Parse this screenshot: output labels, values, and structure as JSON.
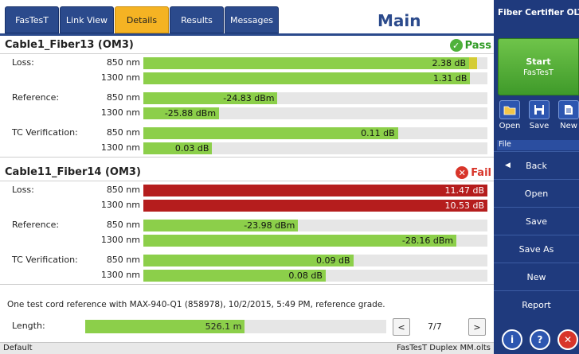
{
  "tabs": [
    "FasTesT",
    "Link View",
    "Details",
    "Results",
    "Messages"
  ],
  "active_tab": "Details",
  "main_title": "Main",
  "cables": [
    {
      "name": "Cable1_Fiber13 (OM3)",
      "verdict": "Pass",
      "verdict_icon": "check-icon",
      "rows": [
        {
          "label": "Loss:",
          "wavelength": "850 nm",
          "value": "2.38 dB",
          "level_pct": 97,
          "color": "green",
          "warn_tip": true
        },
        {
          "label": "",
          "wavelength": "1300 nm",
          "value": "1.31 dB",
          "level_pct": 95,
          "color": "green",
          "warn_tip": false
        },
        {
          "label": "Reference:",
          "wavelength": "850 nm",
          "value": "-24.83 dBm",
          "level_pct": 39,
          "color": "green",
          "warn_tip": false
        },
        {
          "label": "",
          "wavelength": "1300 nm",
          "value": "-25.88 dBm",
          "level_pct": 22,
          "color": "green",
          "warn_tip": false
        },
        {
          "label": "TC Verification:",
          "wavelength": "850 nm",
          "value": "0.11 dB",
          "level_pct": 74,
          "color": "green",
          "warn_tip": false
        },
        {
          "label": "",
          "wavelength": "1300 nm",
          "value": "0.03 dB",
          "level_pct": 20,
          "color": "green",
          "warn_tip": false
        }
      ]
    },
    {
      "name": "Cable11_Fiber14 (OM3)",
      "verdict": "Fail",
      "verdict_icon": "x-icon",
      "rows": [
        {
          "label": "Loss:",
          "wavelength": "850 nm",
          "value": "11.47 dB",
          "level_pct": 100,
          "color": "red",
          "warn_tip": false
        },
        {
          "label": "",
          "wavelength": "1300 nm",
          "value": "10.53 dB",
          "level_pct": 100,
          "color": "red",
          "warn_tip": false
        },
        {
          "label": "Reference:",
          "wavelength": "850 nm",
          "value": "-23.98 dBm",
          "level_pct": 45,
          "color": "green",
          "warn_tip": false
        },
        {
          "label": "",
          "wavelength": "1300 nm",
          "value": "-28.16 dBm",
          "level_pct": 91,
          "color": "green",
          "warn_tip": false
        },
        {
          "label": "TC Verification:",
          "wavelength": "850 nm",
          "value": "0.09 dB",
          "level_pct": 61,
          "color": "green",
          "warn_tip": false
        },
        {
          "label": "",
          "wavelength": "1300 nm",
          "value": "0.08 dB",
          "level_pct": 53,
          "color": "green",
          "warn_tip": false
        }
      ]
    }
  ],
  "reference_note": "One test cord reference with MAX-940-Q1 (858978), 10/2/2015, 5:49 PM, reference grade.",
  "length": {
    "label": "Length:",
    "value": "526.1 m",
    "level_pct": 53
  },
  "pager": {
    "prev": "<",
    "next": ">",
    "page": "7/7"
  },
  "status": {
    "left": "Default",
    "right": "FasTesT Duplex MM.olts"
  },
  "side": {
    "title": "Fiber Certifier OLTS",
    "start_label": "Start",
    "start_sub": "FasTesT",
    "tools": [
      {
        "label": "Open",
        "icon": "folder-icon"
      },
      {
        "label": "Save",
        "icon": "floppy-icon"
      },
      {
        "label": "New",
        "icon": "document-icon"
      }
    ],
    "file_label": "File",
    "menu": [
      "Back",
      "Open",
      "Save",
      "Save As",
      "New",
      "Report"
    ],
    "bottom_icons": [
      "info-icon",
      "help-icon",
      "close-icon"
    ]
  },
  "colors": {
    "green_bar": "#8ccf4a",
    "red_bar": "#b51d1d",
    "tab_blue": "#2b4a8c",
    "tab_active": "#f5b323",
    "panel_blue": "#1f3a7d",
    "pass": "#2f9a24",
    "fail": "#d8352a"
  }
}
